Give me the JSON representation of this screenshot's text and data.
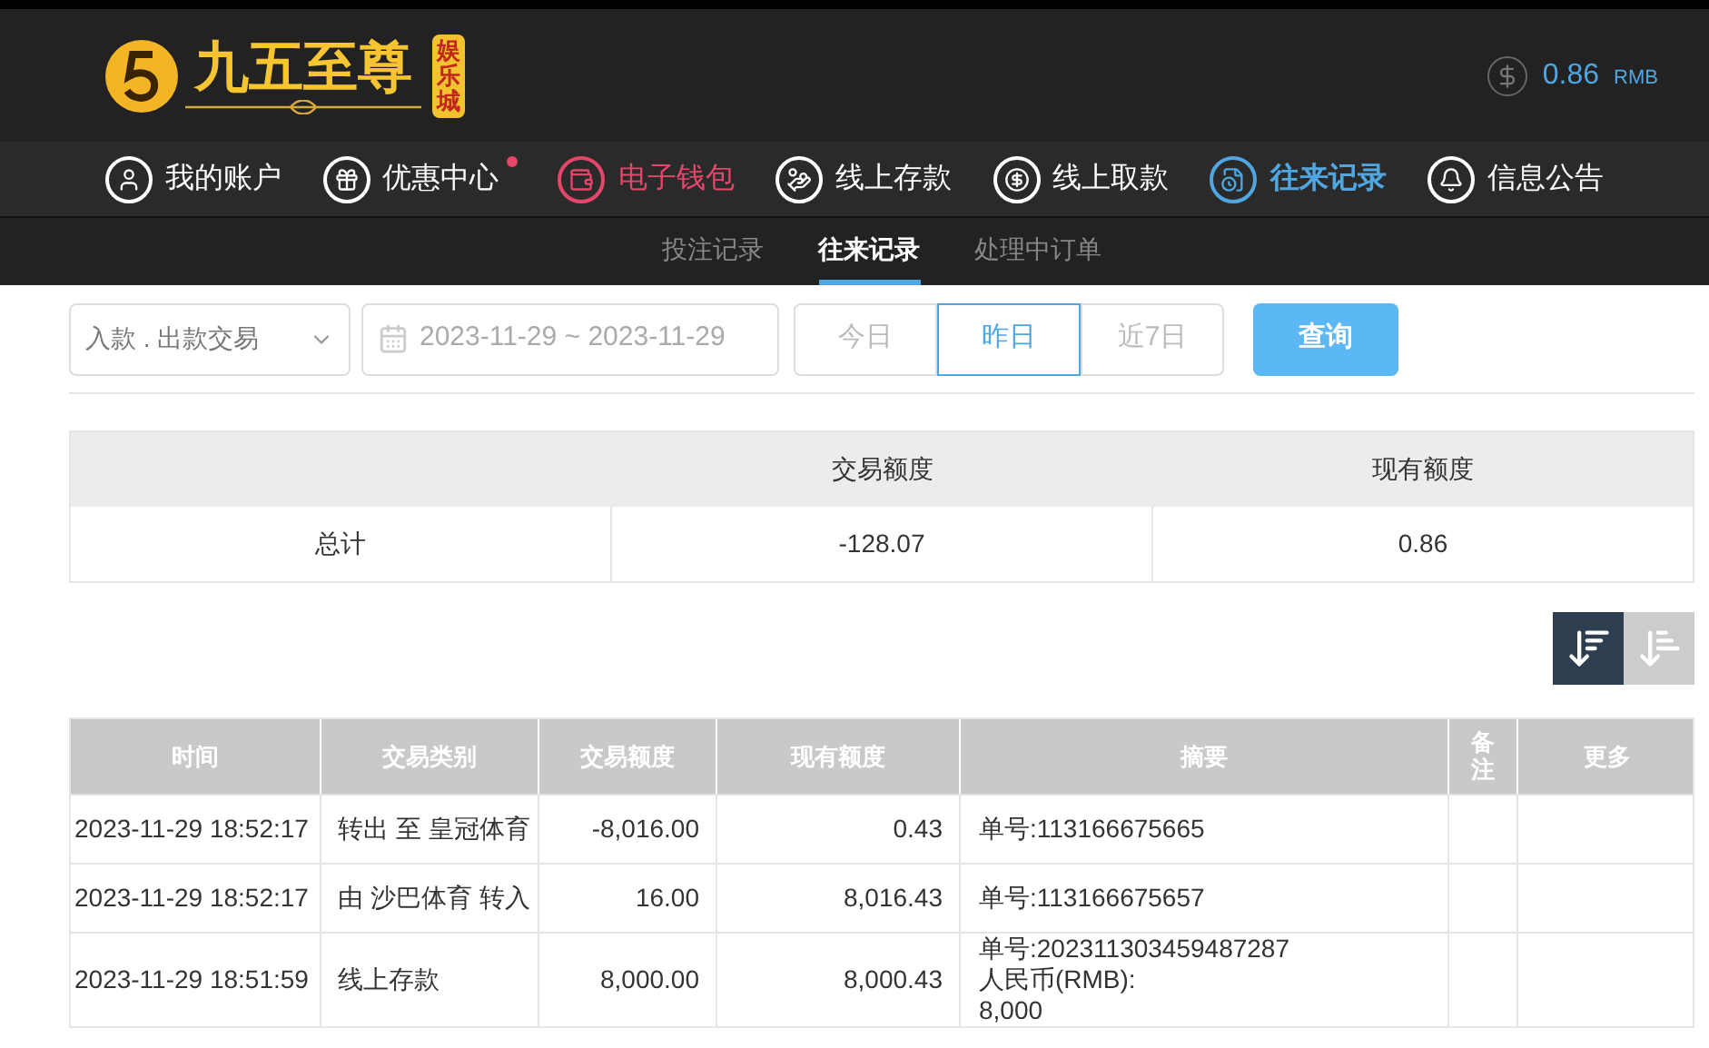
{
  "header": {
    "logo_text": "九五至尊",
    "logo_badge": "娱乐城",
    "balance": "0.86",
    "currency": "RMB"
  },
  "nav": [
    {
      "label": "我的账户",
      "selected": false,
      "dot": false
    },
    {
      "label": "优惠中心",
      "selected": false,
      "dot": true
    },
    {
      "label": "电子钱包",
      "selected": false,
      "dot": false,
      "color": "#e8456b"
    },
    {
      "label": "线上存款",
      "selected": false,
      "dot": false
    },
    {
      "label": "线上取款",
      "selected": false,
      "dot": false
    },
    {
      "label": "往来记录",
      "selected": true,
      "dot": false,
      "color": "#4fa6e0"
    },
    {
      "label": "信息公告",
      "selected": false,
      "dot": false
    }
  ],
  "subnav": [
    {
      "label": "投注记录",
      "selected": false
    },
    {
      "label": "往来记录",
      "selected": true
    },
    {
      "label": "处理中订单",
      "selected": false
    }
  ],
  "filters": {
    "type_select": "入款 . 出款交易",
    "date_range": "2023-11-29 ~ 2023-11-29",
    "quick_ranges": [
      {
        "label": "今日",
        "selected": false
      },
      {
        "label": "昨日",
        "selected": true
      },
      {
        "label": "近7日",
        "selected": false
      }
    ],
    "query_button": "查询"
  },
  "summary": {
    "columns": [
      "交易额度",
      "现有额度"
    ],
    "row": {
      "label": "总计",
      "amount": "-128.07",
      "balance": "0.86"
    }
  },
  "sort_buttons": [
    {
      "kind": "desc",
      "selected": true
    },
    {
      "kind": "asc",
      "selected": false
    }
  ],
  "table": {
    "columns": [
      "时间",
      "交易类别",
      "交易额度",
      "现有额度",
      "摘要",
      "备注",
      "更多"
    ],
    "rows": [
      {
        "time": "2023-11-29 18:52:17",
        "type": "转出 至 皇冠体育",
        "amount": "-8,016.00",
        "balance": "0.43",
        "summary": [
          "单号:113166675665"
        ]
      },
      {
        "time": "2023-11-29 18:52:17",
        "type": "由 沙巴体育 转入",
        "amount": "16.00",
        "balance": "8,016.43",
        "summary": [
          "单号:113166675657"
        ]
      },
      {
        "time": "2023-11-29 18:51:59",
        "type": "线上存款",
        "amount": "8,000.00",
        "balance": "8,000.43",
        "summary": [
          "单号:202311303459487287",
          "人民币(RMB):",
          "8,000"
        ]
      }
    ]
  }
}
